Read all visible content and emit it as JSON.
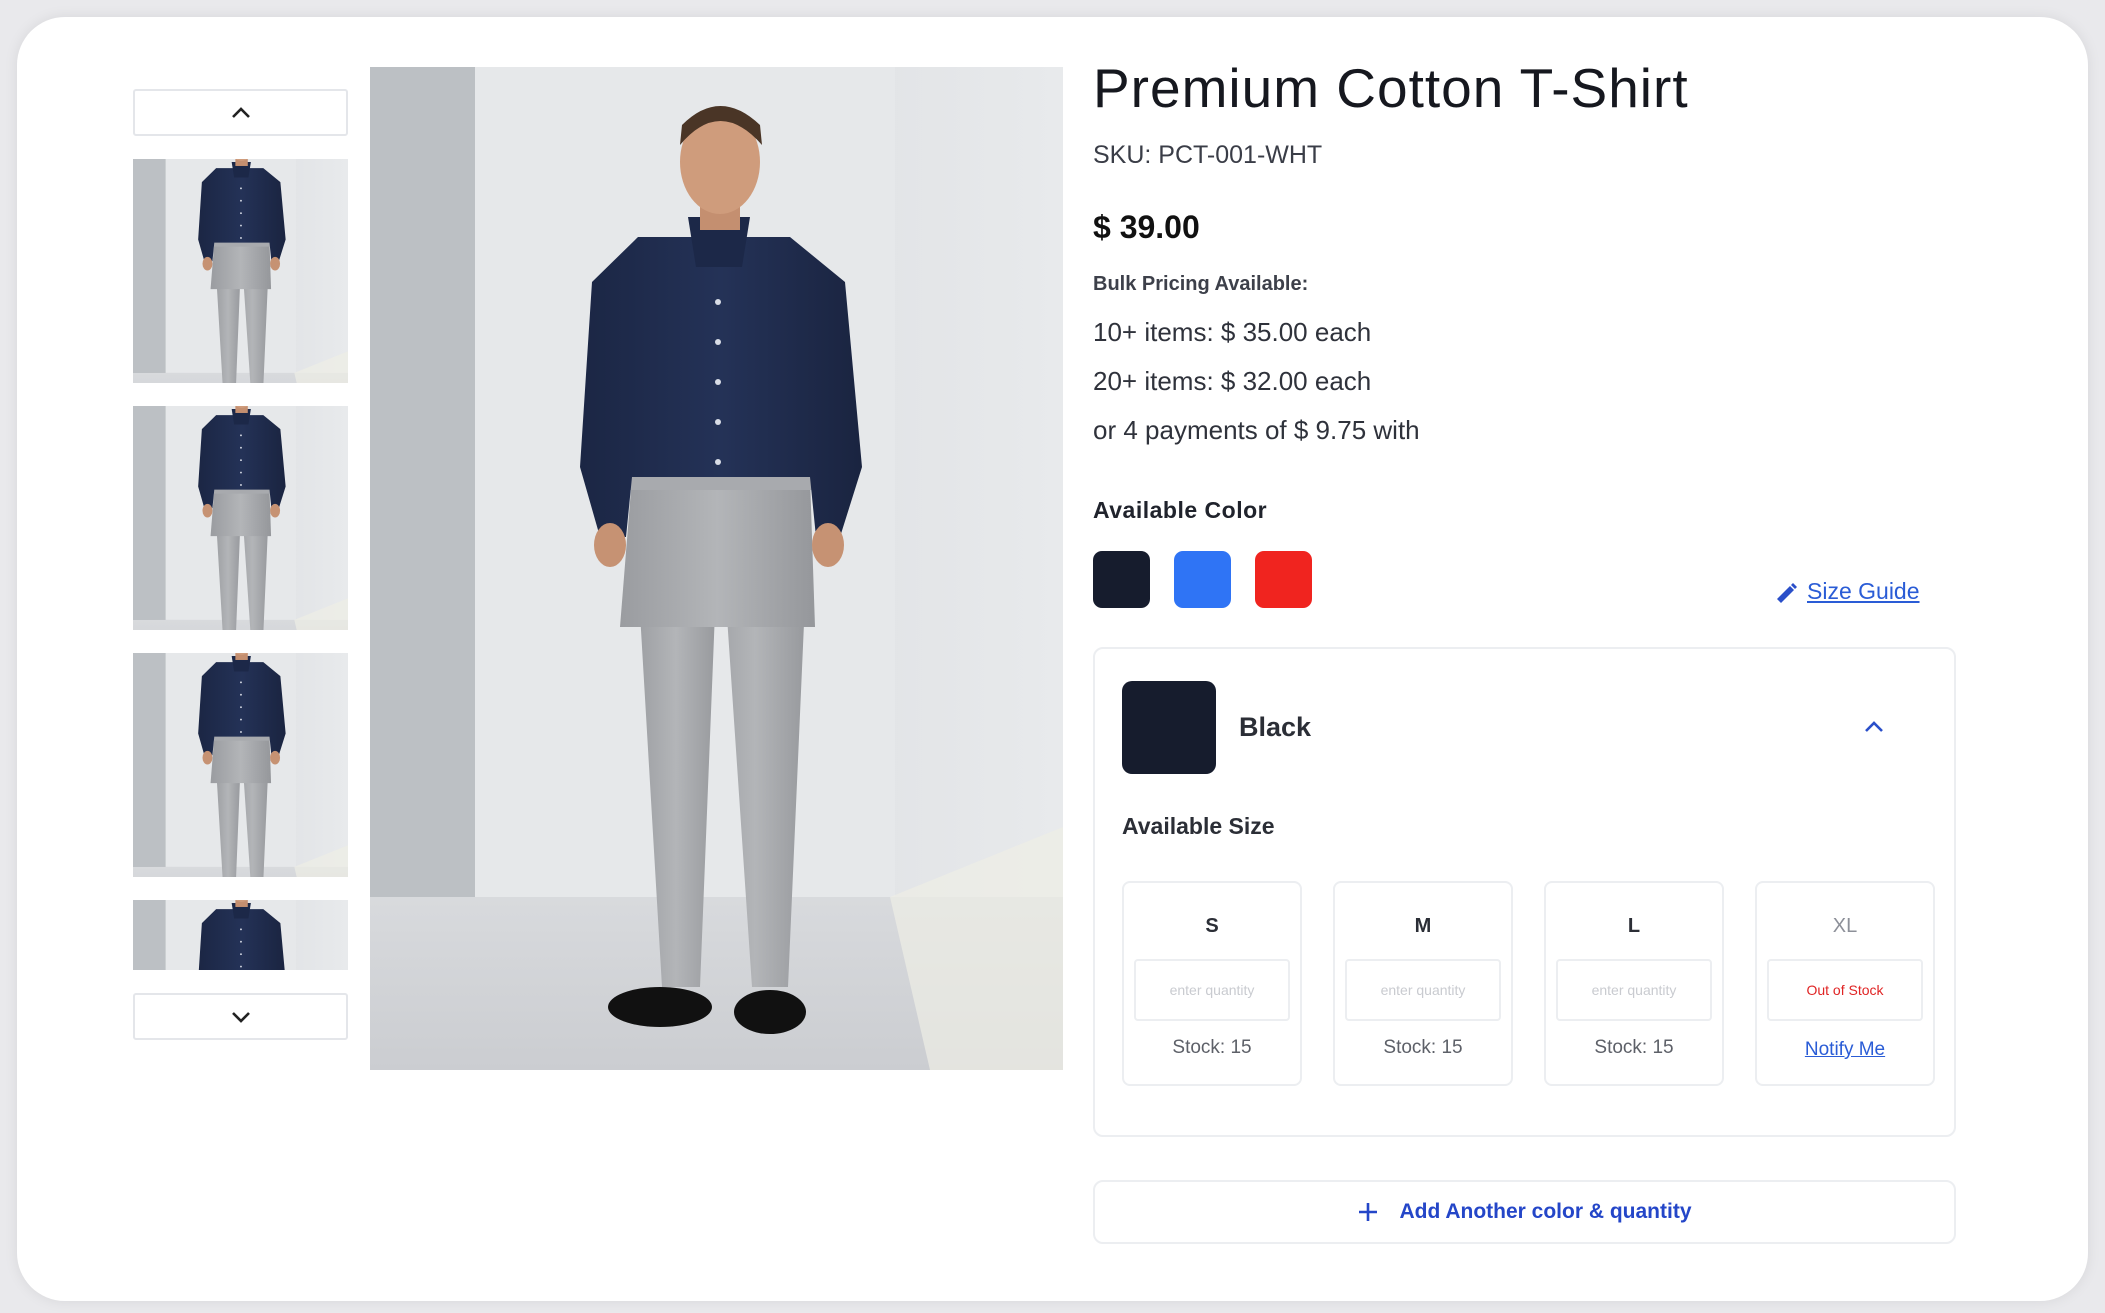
{
  "product": {
    "title": "Premium Cotton T-Shirt",
    "sku": "SKU: PCT-001-WHT",
    "price": "$ 39.00",
    "bulk_heading": "Bulk Pricing Available:",
    "bulk_lines": [
      "10+ items: $ 35.00 each",
      "20+ items: $ 32.00 each",
      "or 4 payments of $ 9.75 with"
    ]
  },
  "colors": {
    "label": "Available  Color",
    "swatches": [
      {
        "name": "navy",
        "hex": "#161c2d"
      },
      {
        "name": "blue",
        "hex": "#2f74f5"
      },
      {
        "name": "red",
        "hex": "#f0241f"
      }
    ],
    "size_guide": "Size Guide"
  },
  "variant": {
    "name": "Black",
    "swatch_hex": "#161c2d",
    "size_label": "Available Size",
    "sizes": [
      {
        "size": "S",
        "placeholder": "enter quantity",
        "stock": "Stock: 15"
      },
      {
        "size": "M",
        "placeholder": "enter quantity",
        "stock": "Stock: 15"
      },
      {
        "size": "L",
        "placeholder": "enter quantity",
        "stock": "Stock: 15"
      },
      {
        "size": "XL",
        "status": "Out of Stock",
        "action": "Notify Me"
      }
    ]
  },
  "add_button": "Add Another color & quantity",
  "icons": {
    "gallery_up": "chevron-up-icon",
    "gallery_down": "chevron-down-icon",
    "size_guide": "ruler-pencil-icon",
    "collapse": "chevron-up-icon",
    "add": "plus-icon"
  },
  "theme": {
    "accent": "#2a5cd6",
    "error": "#e02424"
  }
}
